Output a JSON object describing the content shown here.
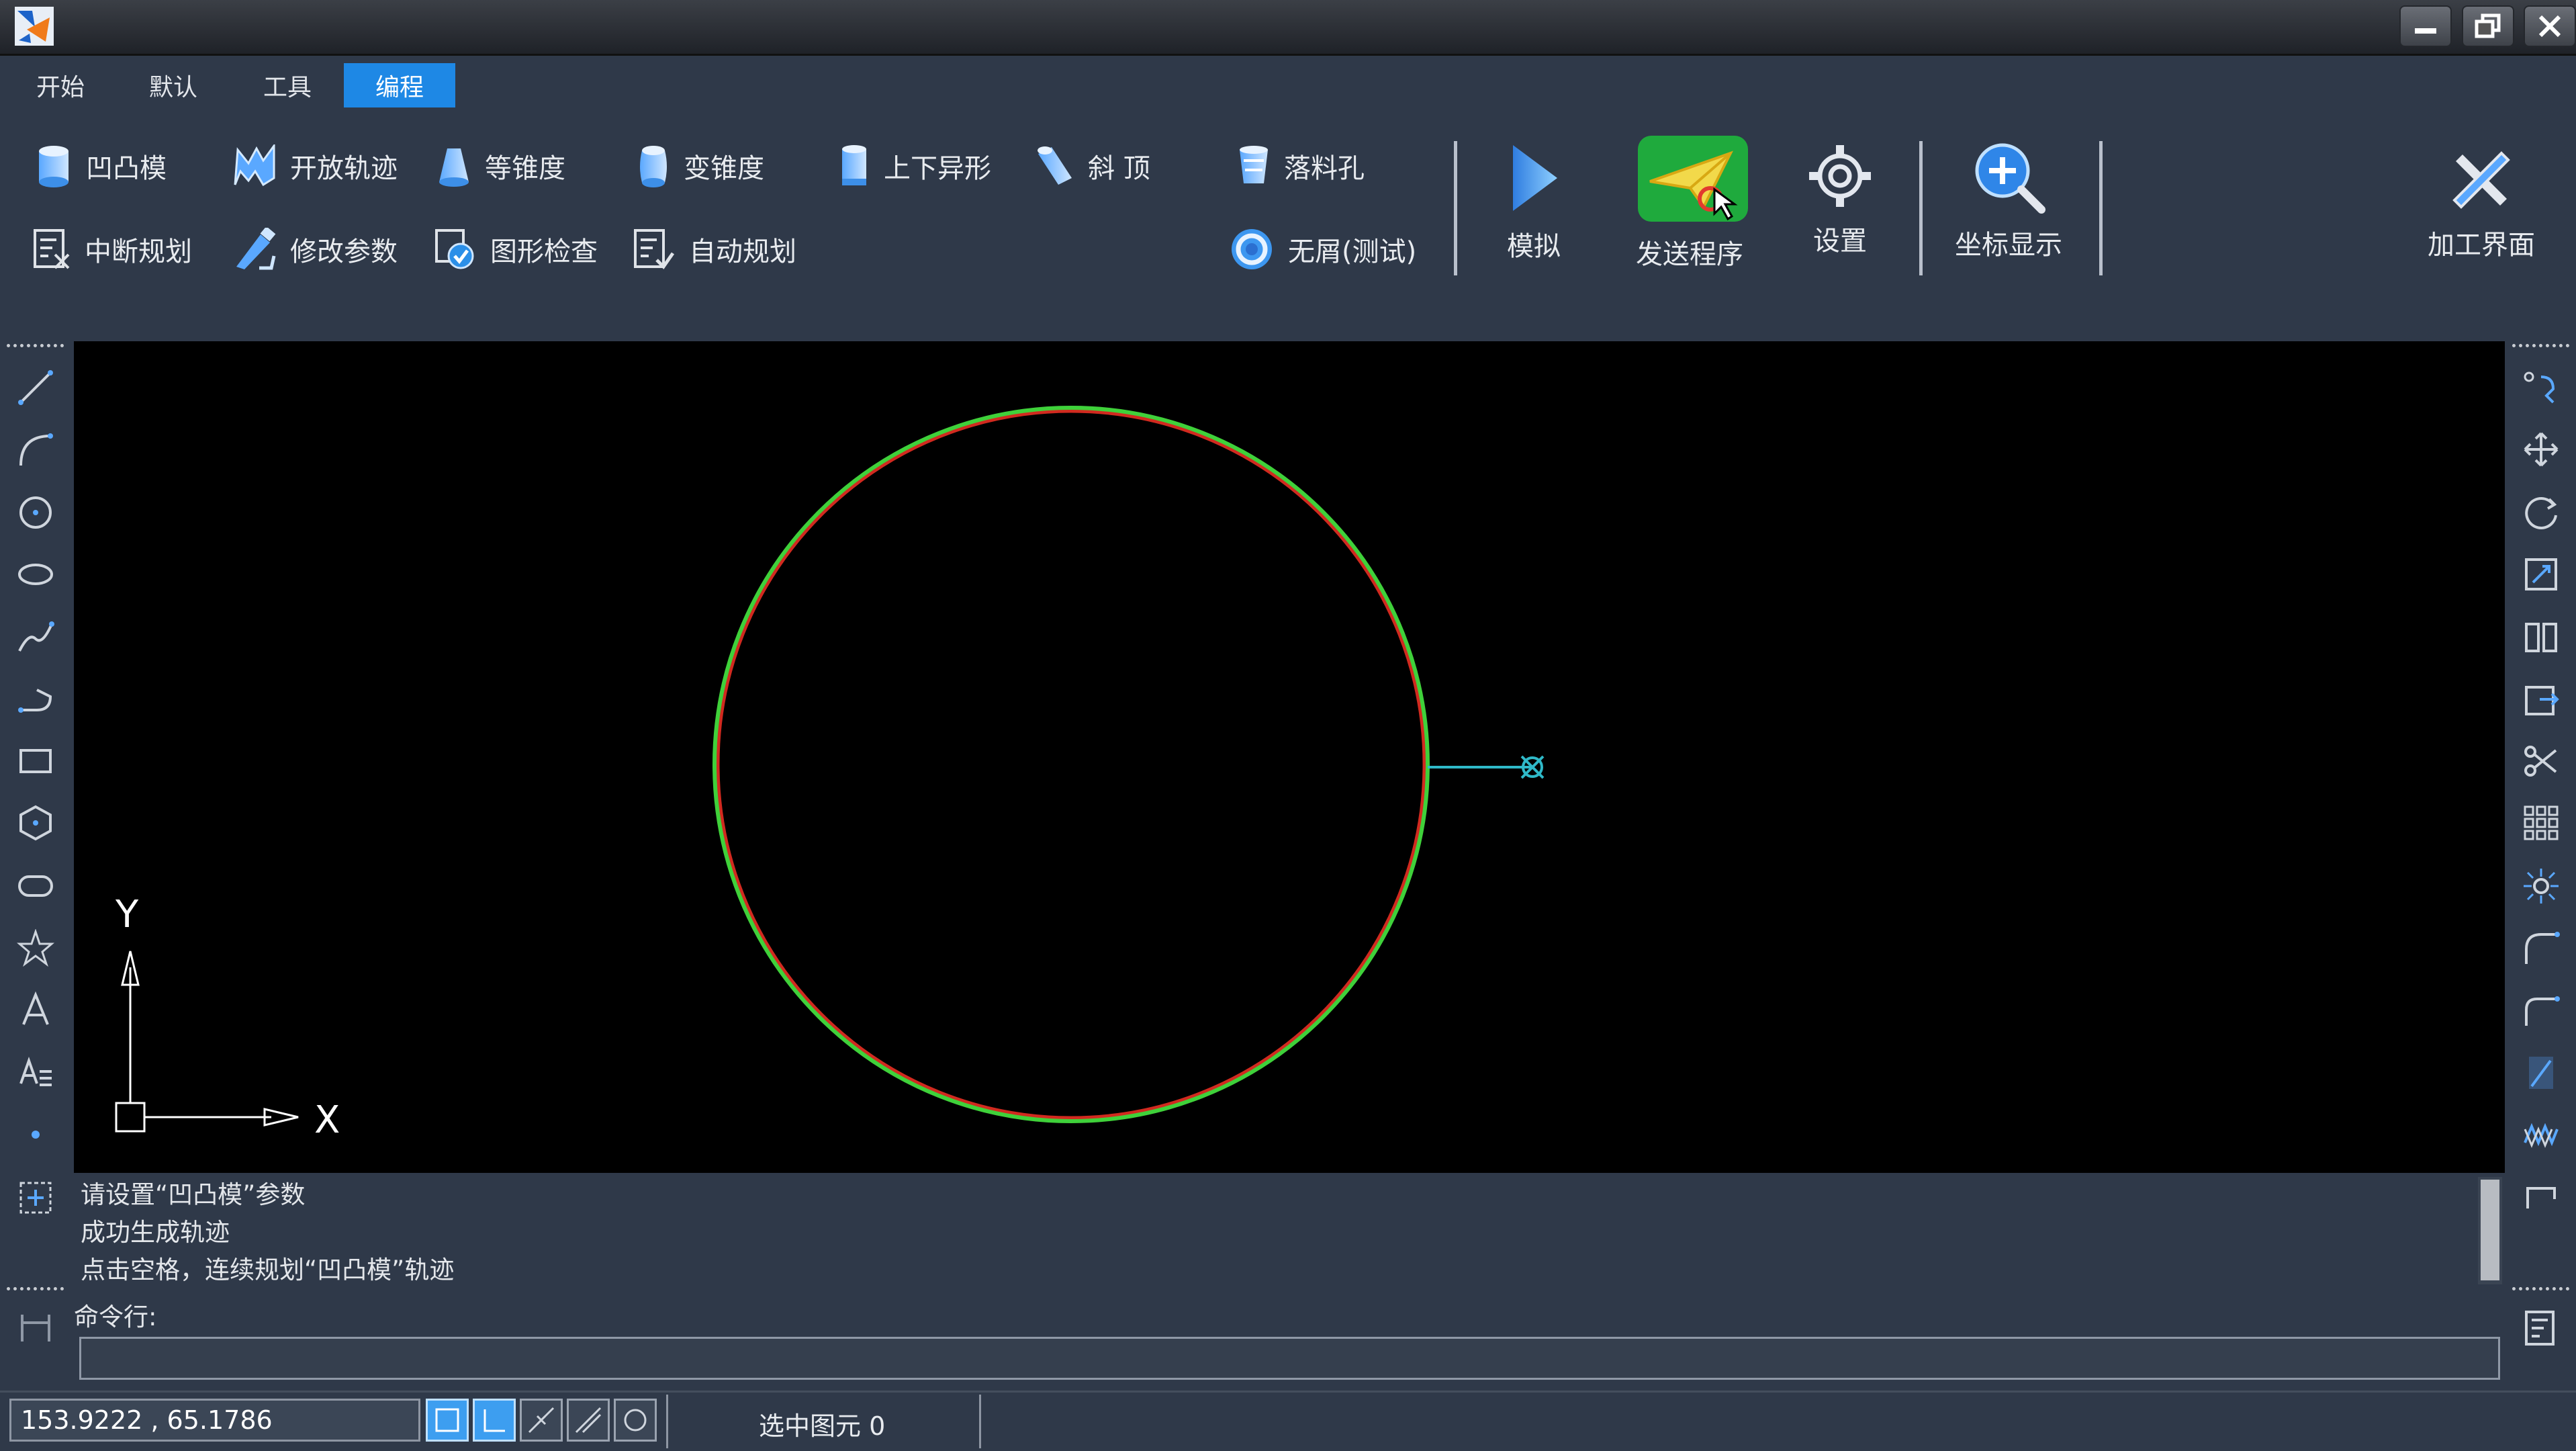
{
  "menu": {
    "tabs": [
      {
        "label": "开始"
      },
      {
        "label": "默认"
      },
      {
        "label": "工具"
      },
      {
        "label": "编程",
        "active": true
      }
    ]
  },
  "ribbon": {
    "row1": [
      {
        "label": "凹凸模",
        "icon": "die-cylinder-icon"
      },
      {
        "label": "开放轨迹",
        "icon": "open-path-icon"
      },
      {
        "label": "等锥度",
        "icon": "equal-taper-icon"
      },
      {
        "label": "变锥度",
        "icon": "variable-taper-icon"
      },
      {
        "label": "上下异形",
        "icon": "upper-lower-shape-icon"
      },
      {
        "label": "斜 顶",
        "icon": "oblique-top-icon"
      },
      {
        "label": "落料孔",
        "icon": "blanking-hole-icon"
      }
    ],
    "row2": [
      {
        "label": "中断规划",
        "icon": "interrupt-plan-icon"
      },
      {
        "label": "修改参数",
        "icon": "modify-params-icon"
      },
      {
        "label": "图形检查",
        "icon": "shape-check-icon"
      },
      {
        "label": "自动规划",
        "icon": "auto-plan-icon"
      },
      {
        "label": "无屑(测试)",
        "icon": "no-chip-icon"
      }
    ],
    "big": [
      {
        "label": "模拟",
        "icon": "play-icon"
      },
      {
        "label": "发送程序",
        "icon": "send-program-icon"
      },
      {
        "label": "设置",
        "icon": "gear-icon"
      },
      {
        "label": "坐标显示",
        "icon": "zoom-coordinate-icon"
      },
      {
        "label": "加工界面",
        "icon": "machining-tools-icon"
      }
    ]
  },
  "canvas": {
    "axis_x_label": "X",
    "axis_y_label": "Y",
    "colors": {
      "path": "#3fd13a",
      "contour": "#d12a1f",
      "lead": "#2fb9c8"
    }
  },
  "output": {
    "lines": [
      "请设置“凹凸模”参数",
      "成功生成轨迹",
      "点击空格，连续规划“凹凸模”轨迹"
    ]
  },
  "command": {
    "label": "命令行:",
    "value": ""
  },
  "status": {
    "coord": "153.9222 , 65.1786",
    "selected": "选中图元 0"
  }
}
